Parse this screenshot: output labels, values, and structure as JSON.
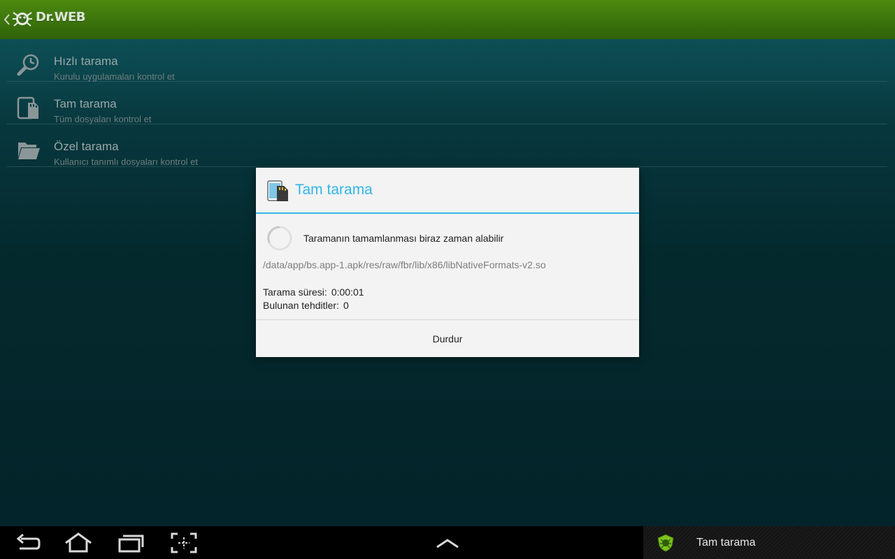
{
  "app": {
    "logo_text": "Dr.WEB",
    "accent_color": "#33b5e5",
    "brand_color": "#3a720c"
  },
  "scan_options": [
    {
      "icon": "clock-magnifier-icon",
      "title": "Hızlı tarama",
      "subtitle": "Kurulu uygulamaları kontrol et"
    },
    {
      "icon": "phone-sdcard-icon",
      "title": "Tam tarama",
      "subtitle": "Tüm dosyaları kontrol et"
    },
    {
      "icon": "folder-icon",
      "title": "Özel tarama",
      "subtitle": "Kullanıcı tanımlı dosyaları kontrol et"
    }
  ],
  "dialog": {
    "title": "Tam tarama",
    "icon": "phone-sdcard-icon",
    "message": "Taramanın tamamlanması biraz zaman alabilir",
    "current_file": "/data/app/bs.app-1.apk/res/raw/fbr/lib/x86/libNativeFormats-v2.so",
    "duration_label": "Tarama süresi:",
    "duration_value": "0:00:01",
    "threats_label": "Bulunan tehditler:",
    "threats_value": "0",
    "stop_label": "Durdur"
  },
  "navbar": {
    "buttons": [
      "back-icon",
      "home-icon",
      "recent-apps-icon",
      "screenshot-icon",
      "chevron-up-icon"
    ]
  },
  "notification": {
    "text": "Tam tarama",
    "icon": "drweb-shield-icon"
  }
}
